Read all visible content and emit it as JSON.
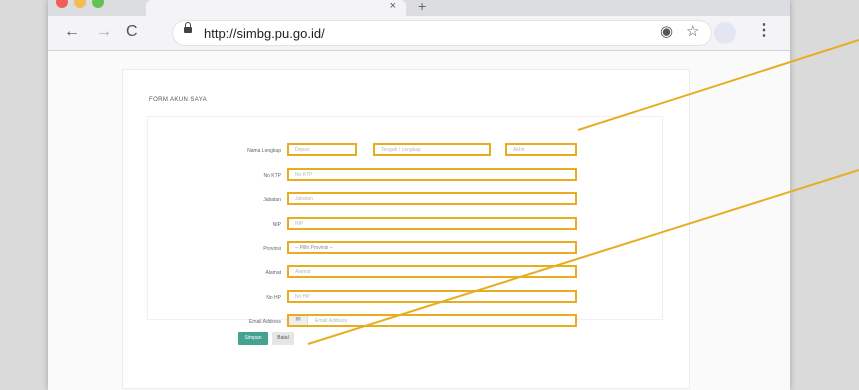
{
  "browser": {
    "url": "http://simbg.pu.go.id/",
    "tab_close": "×",
    "new_tab": "+",
    "nav_back": "←",
    "nav_forward": "→",
    "nav_reload": "C",
    "menu": "⋮",
    "location_icon": "◉",
    "star_icon": "☆"
  },
  "form": {
    "title": "FORM AKUN SAYA",
    "fields": [
      {
        "label": "Nama Lengkap"
      },
      {
        "label": "No KTP",
        "placeholder": "No KTP"
      },
      {
        "label": "Jabatan",
        "placeholder": "Jabatan"
      },
      {
        "label": "NIP",
        "placeholder": "NIP"
      },
      {
        "label": "Provinsi",
        "placeholder": "-- Pilih Provinsi --"
      },
      {
        "label": "Alamat",
        "placeholder": "Alamat"
      },
      {
        "label": "No HP",
        "placeholder": "No HP"
      },
      {
        "label": "Email Address",
        "placeholder": "Email Address"
      }
    ],
    "name_parts": [
      "Depan",
      "Tengah / Lengkap",
      "Akhir"
    ],
    "email_prefix": "✉",
    "submit_label": "Simpan",
    "cancel_label": "Batal"
  },
  "colors": {
    "highlight": "#e7ad21",
    "primary_button": "#43a390",
    "annotation_line": "#e7ad21"
  }
}
